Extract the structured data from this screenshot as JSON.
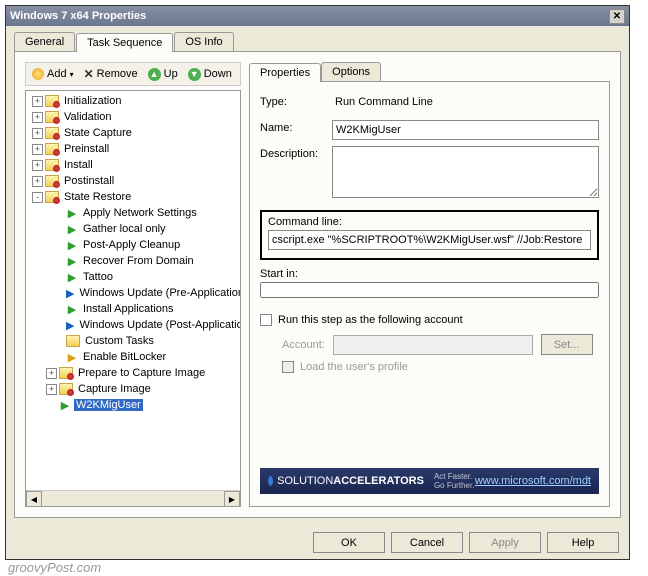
{
  "window": {
    "title": "Windows 7 x64 Properties"
  },
  "mainTabs": [
    "General",
    "Task Sequence",
    "OS Info"
  ],
  "mainActive": 1,
  "toolbar": {
    "add": "Add",
    "remove": "Remove",
    "up": "Up",
    "down": "Down"
  },
  "tree": {
    "l1": [
      {
        "label": "Initialization",
        "exp": "+"
      },
      {
        "label": "Validation",
        "exp": "+"
      },
      {
        "label": "State Capture",
        "exp": "+"
      },
      {
        "label": "Preinstall",
        "exp": "+"
      },
      {
        "label": "Install",
        "exp": "+"
      },
      {
        "label": "Postinstall",
        "exp": "+"
      },
      {
        "label": "State Restore",
        "exp": "-"
      }
    ],
    "stateRestoreChildren": [
      {
        "label": "Apply Network Settings",
        "kind": "green"
      },
      {
        "label": "Gather local only",
        "kind": "green"
      },
      {
        "label": "Post-Apply Cleanup",
        "kind": "green"
      },
      {
        "label": "Recover From Domain",
        "kind": "green"
      },
      {
        "label": "Tattoo",
        "kind": "green"
      },
      {
        "label": "Windows Update (Pre-Application Installa",
        "kind": "blue"
      },
      {
        "label": "Install Applications",
        "kind": "green"
      },
      {
        "label": "Windows Update (Post-Application Install",
        "kind": "blue"
      },
      {
        "label": "Custom Tasks",
        "kind": "folder",
        "exp": ""
      },
      {
        "label": "Enable BitLocker",
        "kind": "yellow"
      }
    ],
    "tail": [
      {
        "label": "Prepare to Capture Image",
        "exp": "+"
      },
      {
        "label": "Capture Image",
        "exp": "+"
      }
    ],
    "selected": "W2KMigUser"
  },
  "rightTabs": [
    "Properties",
    "Options"
  ],
  "props": {
    "typeLabel": "Type:",
    "typeValue": "Run Command Line",
    "nameLabel": "Name:",
    "nameValue": "W2KMigUser",
    "descLabel": "Description:",
    "descValue": "",
    "cmdLabel": "Command line:",
    "cmdValue": "cscript.exe \"%SCRIPTROOT%\\W2KMigUser.wsf\" //Job:Restore",
    "startLabel": "Start in:",
    "startValue": "",
    "runAs": "Run this step as the following account",
    "account": "Account:",
    "setBtn": "Set...",
    "loadProfile": "Load the user's profile"
  },
  "banner": {
    "brand1": "SOLUTION",
    "brand2": "ACCELERATORS",
    "tag": "Act Faster. Go Further.",
    "link": "www.microsoft.com/mdt"
  },
  "buttons": {
    "ok": "OK",
    "cancel": "Cancel",
    "apply": "Apply",
    "help": "Help"
  },
  "watermark": "groovyPost.com"
}
